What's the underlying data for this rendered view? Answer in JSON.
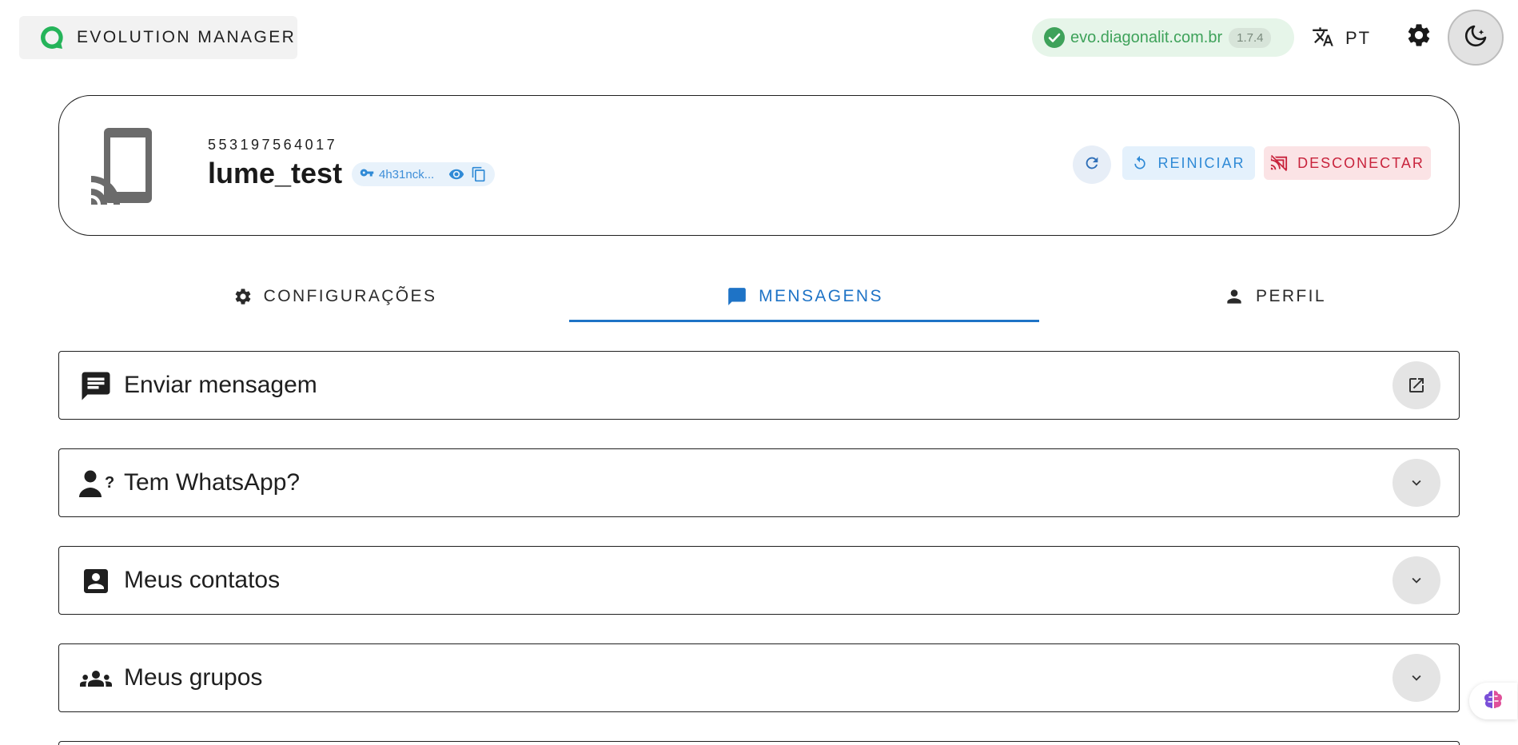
{
  "header": {
    "app_title": "EVOLUTION MANAGER",
    "server_url": "evo.diagonalit.com.br",
    "version": "1.7.4",
    "language": "PT"
  },
  "instance": {
    "number": "553197564017",
    "name": "lume_test",
    "token_masked": "4h31nck...",
    "restart_label": "REINICIAR",
    "disconnect_label": "DESCONECTAR"
  },
  "tabs": [
    {
      "label": "CONFIGURAÇÕES",
      "icon": "gear-icon",
      "active": false
    },
    {
      "label": "MENSAGENS",
      "icon": "message-icon",
      "active": true
    },
    {
      "label": "PERFIL",
      "icon": "person-icon",
      "active": false
    }
  ],
  "sections": [
    {
      "title": "Enviar mensagem",
      "icon": "chat-lines-icon",
      "action": "open-external-icon"
    },
    {
      "title": "Tem WhatsApp?",
      "icon": "person-question-icon",
      "action": "chevron-down-icon"
    },
    {
      "title": "Meus contatos",
      "icon": "contact-card-icon",
      "action": "chevron-down-icon"
    },
    {
      "title": "Meus grupos",
      "icon": "groups-icon",
      "action": "chevron-down-icon"
    }
  ],
  "colors": {
    "accent": "#1e73c6",
    "success": "#3ea25a",
    "danger": "#c8233c"
  }
}
